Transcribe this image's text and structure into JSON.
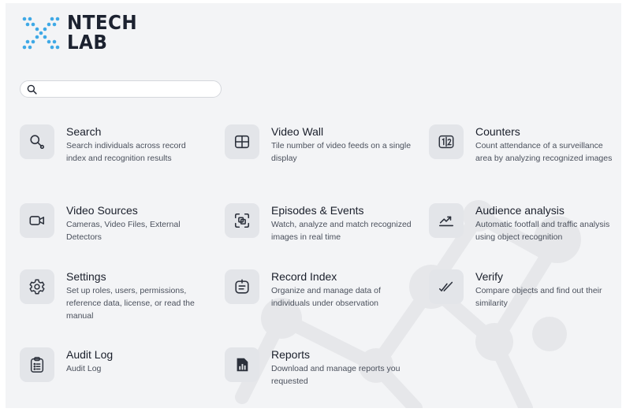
{
  "brand": {
    "name_line1": "NTECH",
    "name_line2": "LAB"
  },
  "search": {
    "placeholder": "",
    "value": ""
  },
  "tiles": [
    {
      "title": "Search",
      "description": "Search individuals across record index and recognition results",
      "icon": "search-icon"
    },
    {
      "title": "Video Wall",
      "description": "Tile number of video feeds on a single display",
      "icon": "grid-layout-icon"
    },
    {
      "title": "Counters",
      "description": "Count attendance of a surveillance area by analyzing recognized images",
      "icon": "counter-icon"
    },
    {
      "title": "Video Sources",
      "description": "Cameras, Video Files, External Detectors",
      "icon": "video-camera-icon"
    },
    {
      "title": "Episodes & Events",
      "description": "Watch, analyze and match recognized images in real time",
      "icon": "episodes-icon"
    },
    {
      "title": "Audience analysis",
      "description": "Automatic footfall and traffic analysis using object recognition",
      "icon": "trend-icon"
    },
    {
      "title": "Settings",
      "description": "Set up roles, users, permissions, reference data, license, or read the manual",
      "icon": "gear-icon"
    },
    {
      "title": "Record Index",
      "description": "Organize and manage data of individuals under observation",
      "icon": "record-index-icon"
    },
    {
      "title": "Verify",
      "description": "Compare objects and find out their similarity",
      "icon": "double-check-icon"
    },
    {
      "title": "Audit Log",
      "description": "Audit Log",
      "icon": "clipboard-list-icon"
    },
    {
      "title": "Reports",
      "description": "Download and manage reports you requested",
      "icon": "report-icon"
    }
  ],
  "colors": {
    "brand_blue": "#3fa9e6",
    "background": "#f3f4f6",
    "icon_tile": "#e3e5e9",
    "text": "#1a1f2b"
  }
}
